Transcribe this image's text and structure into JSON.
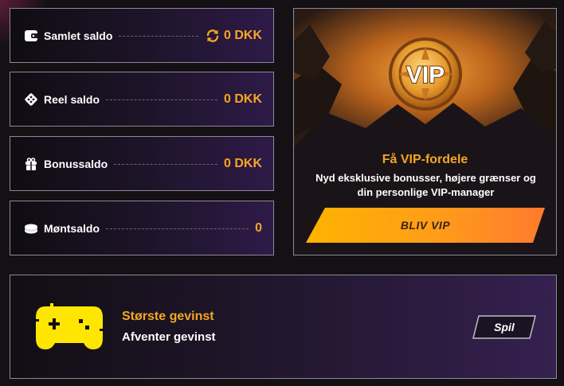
{
  "balances": [
    {
      "label": "Samlet saldo",
      "value": "0 DKK",
      "icon": "wallet-icon",
      "has_refresh": true
    },
    {
      "label": "Reel saldo",
      "value": "0 DKK",
      "icon": "dice-icon",
      "has_refresh": false
    },
    {
      "label": "Bonussaldo",
      "value": "0 DKK",
      "icon": "gift-icon",
      "has_refresh": false
    },
    {
      "label": "Møntsaldo",
      "value": "0",
      "icon": "coins-icon",
      "has_refresh": false
    }
  ],
  "vip": {
    "badge_text": "VIP",
    "title": "Få VIP-fordele",
    "description": "Nyd eksklusive bonusser, højere grænser og din personlige VIP-manager",
    "button_label": "BLIV VIP"
  },
  "biggest_win": {
    "title": "Største gevinst",
    "subtitle": "Afventer gevinst",
    "play_label": "Spil",
    "icon": "gamepad-icon"
  },
  "colors": {
    "accent": "#f5a623",
    "gamepad": "#ffe600",
    "button_gradient_start": "#ffb300",
    "button_gradient_end": "#ff7a2e"
  }
}
